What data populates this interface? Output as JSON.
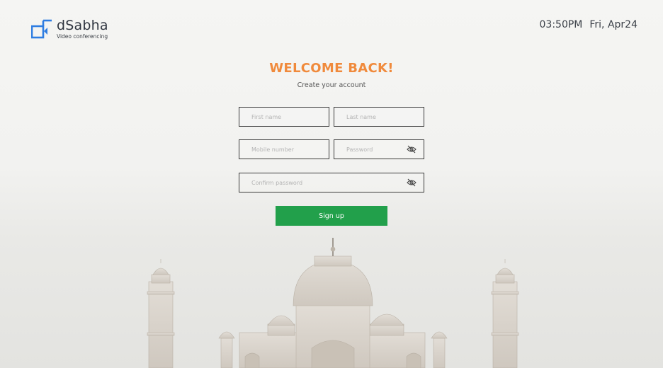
{
  "brand": {
    "name": "dSabha",
    "tagline": "Video conferencing"
  },
  "clock": {
    "time": "03:50PM",
    "date": "Fri, Apr24"
  },
  "form": {
    "heading": "WELCOME BACK!",
    "subheading": "Create your account",
    "first_name_placeholder": "First name",
    "last_name_placeholder": "Last name",
    "mobile_placeholder": "Mobile number",
    "password_placeholder": "Password",
    "confirm_password_placeholder": "Confirm password",
    "submit_label": "Sign up"
  },
  "icons": {
    "logo": "dsabha-logo-icon",
    "password_toggle": "eye-slash-icon"
  },
  "colors": {
    "accent": "#f08a3c",
    "primary_button": "#22a04b",
    "logo_blue": "#2f7de1"
  }
}
